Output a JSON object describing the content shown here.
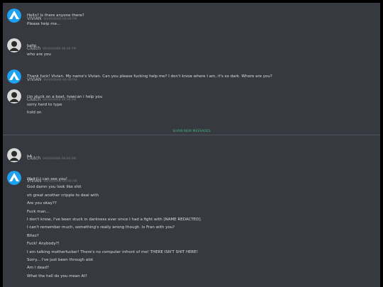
{
  "colors": {
    "background": "#36393f",
    "frame": "#000000",
    "accent_green": "#43b581",
    "avatar_blue": "#1da1f2"
  },
  "divider_label": "SHOW NEW MESSAGES",
  "messages": [
    {
      "author": "VIVIAN",
      "timestamp": "99/99/9999 99:99 PM",
      "avatar": "aperture-logo-icon",
      "lines": [
        "Hello? Is there anyone there?",
        "Please help me..."
      ]
    },
    {
      "author": "Clutch",
      "timestamp": "99/99/9999 99:99 PM",
      "avatar": "default-user-icon",
      "lines": [
        "hello",
        "who are you"
      ]
    },
    {
      "author": "VIVIAN",
      "timestamp": "99/99/9999 99:99 PM",
      "avatar": "aperture-logo-icon",
      "lines": [
        "Thank fuck! Vivian. My name's Vivian. Can you please fucking help me? I don't know where I am, it's so dark. Where are you?"
      ]
    },
    {
      "author": "Clutch",
      "timestamp": "99/99/9999 99:99 PM",
      "avatar": "default-user-icon",
      "lines": [
        "i'm stuck on a boat, howcan i help you",
        "sorry hard to type",
        "hold on"
      ]
    },
    {
      "author": "Clutch",
      "timestamp": "99/99/9999 99:99 PM",
      "avatar": "default-user-icon",
      "lines": [
        "hA"
      ]
    },
    {
      "author": "VIVIAN",
      "timestamp": "99/99/9999 99:99 PM",
      "avatar": "aperture-logo-icon",
      "lines": [
        "Wait!! I can see you!",
        "God damn you look like shit",
        "oh great another cripple to deal with",
        "Are you okay??",
        "Fuck man...",
        "I don't know, I've been stuck in darkness ever since I had a fight with [NAME REDACTED].",
        "I can't remember much, something's really wrong though. Is Fran with you?",
        "Bitez?",
        "Fuck! Anybody?!",
        "I am talking motherfucker! There's no computer infront of me! THERE ISN'T SHIT HERE!",
        "Sorry... I've just been through alot",
        "Am I dead?",
        "What the hell do you mean AI?"
      ]
    }
  ]
}
